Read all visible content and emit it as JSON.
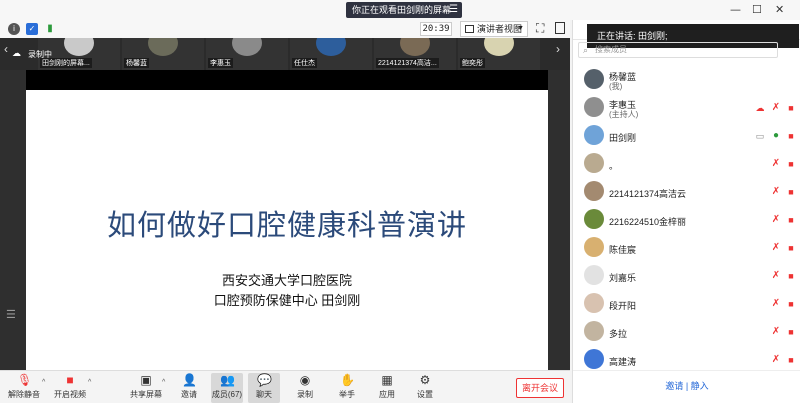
{
  "title_bar": {
    "share_banner": "你正在观看田剑刚的屏幕",
    "menu_glyph": "☰",
    "minimize": "—",
    "maximize": "☐",
    "close": "✕"
  },
  "top_toolbar": {
    "clock": "20:39",
    "view_mode": "演讲者视图",
    "fullscreen_glyph": "⛶",
    "signal_glyph": "▮"
  },
  "panel_header": {
    "tab_chat": "聊天",
    "speaking_label": "正在讲话: 田剑刚;"
  },
  "video_strip": {
    "recording_label": "录制中",
    "prev_glyph": "‹",
    "next_glyph": "›",
    "tiles": [
      {
        "name": "田剑刚的屏幕...",
        "color": "#c9c9c9"
      },
      {
        "name": "杨馨蓝",
        "color": "#6b6b5a"
      },
      {
        "name": "李惠玉",
        "color": "#8a8a8a"
      },
      {
        "name": "任仕杰",
        "color": "#2d5e9c"
      },
      {
        "name": "2214121374高洁...",
        "color": "#7a6a55"
      },
      {
        "name": "鲍奕彤",
        "color": "#d8d3b0"
      }
    ]
  },
  "slide": {
    "title": "如何做好口腔健康科普演讲",
    "line1": "西安交通大学口腔医院",
    "line2": "口腔预防保健中心   田剑刚"
  },
  "bottom_toolbar": {
    "mute": "解除静音",
    "video": "开启视频",
    "share": "共享屏幕",
    "invite": "邀请",
    "participants": "成员(67)",
    "chat": "聊天",
    "record": "录制",
    "raise_hand": "举手",
    "apps": "应用",
    "settings": "设置",
    "leave": "离开会议",
    "caret": "^"
  },
  "participants_panel": {
    "search_placeholder": "搜索成员",
    "search_glyph": "⌕",
    "invite_footer": "邀请 | 静入",
    "members": [
      {
        "name": "杨馨蓝",
        "role": "(我)",
        "color": "#55606a"
      },
      {
        "name": "李惠玉",
        "role": "(主持人)",
        "color": "#8f8f8f"
      },
      {
        "name": "田剑刚",
        "role": "",
        "color": "#6fa3d8"
      },
      {
        "name": "。",
        "role": "",
        "color": "#b9aa90"
      },
      {
        "name": "2214121374高洁云",
        "role": "",
        "color": "#a38a70"
      },
      {
        "name": "2216224510金梓丽",
        "role": "",
        "color": "#6a8a3a"
      },
      {
        "name": "陈佳宸",
        "role": "",
        "color": "#d8b070"
      },
      {
        "name": "刘嘉乐",
        "role": "",
        "color": "#e2e2e2"
      },
      {
        "name": "段开阳",
        "role": "",
        "color": "#d8c2b0"
      },
      {
        "name": "多拉",
        "role": "",
        "color": "#c2b4a0"
      },
      {
        "name": "高建涛",
        "role": "",
        "color": "#3f76d6"
      }
    ]
  },
  "colors": {
    "accent": "#2468d8",
    "danger": "#e33333",
    "slide_title": "#2b4a7a"
  }
}
